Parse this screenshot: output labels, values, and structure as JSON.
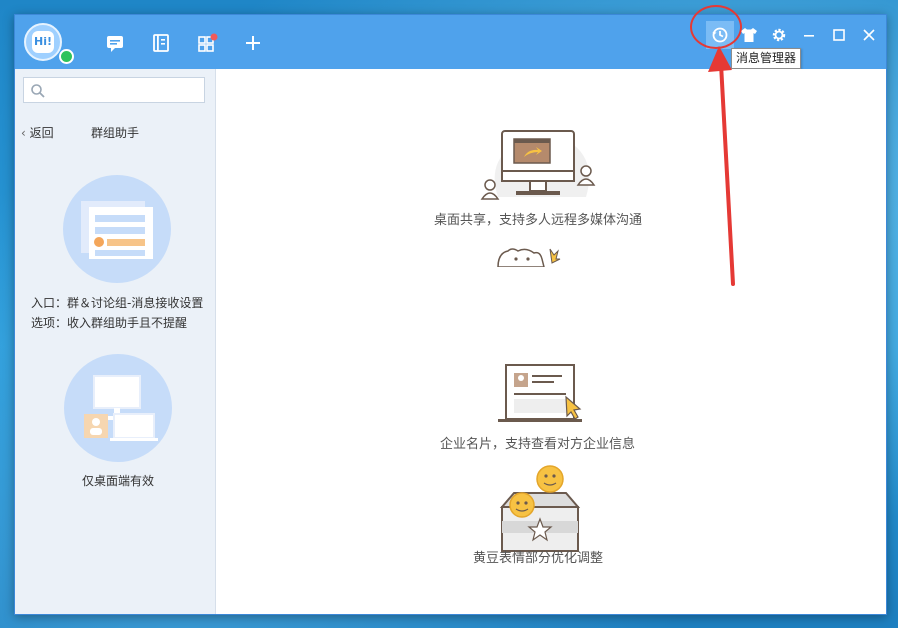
{
  "toolbar": {
    "nav_icons": [
      "chat-icon",
      "contacts-icon",
      "apps-icon",
      "add-icon"
    ],
    "controls": [
      "history-icon",
      "skin-icon",
      "settings-icon",
      "minimize-icon",
      "maximize-icon",
      "close-icon"
    ],
    "tooltip": "消息管理器"
  },
  "avatar": {
    "text": "Hi!"
  },
  "sidebar": {
    "search_placeholder": "",
    "back_label": "返回",
    "title": "群组助手",
    "tip_line1": "入口：群＆讨论组-消息接收设置",
    "tip_line2": "选项：收入群组助手且不提醒",
    "desktop_only": "仅桌面端有效"
  },
  "features": [
    {
      "caption": "桌面共享，支持多人远程多媒体沟通"
    },
    {
      "caption": "企业名片，支持查看对方企业信息"
    },
    {
      "caption": "黄豆表情部分优化调整"
    }
  ],
  "colors": {
    "titlebar": "#4fa2ec",
    "sidebar": "#ebf1f8",
    "accent_red": "#e53935",
    "online": "#2fc35c"
  }
}
